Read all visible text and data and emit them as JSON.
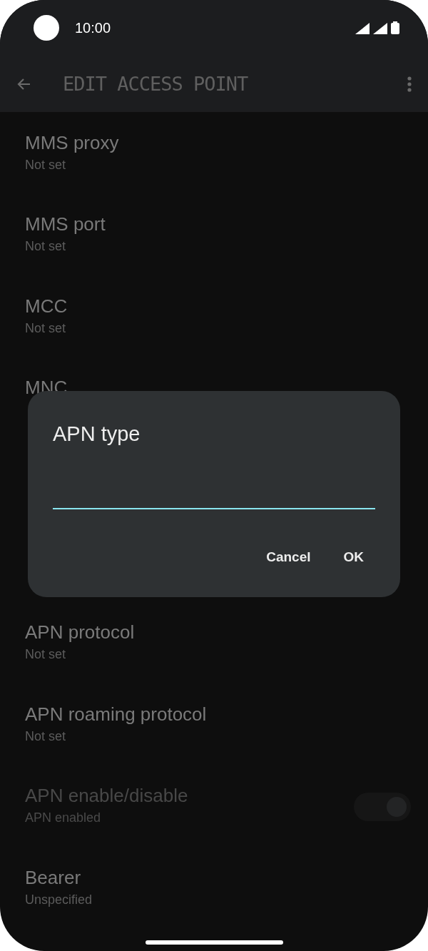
{
  "status_bar": {
    "time": "10:00"
  },
  "toolbar": {
    "title": "EDIT ACCESS POINT"
  },
  "items": [
    {
      "kind": "text",
      "title": "MMS proxy",
      "subtitle": "Not set"
    },
    {
      "kind": "text",
      "title": "MMS port",
      "subtitle": "Not set"
    },
    {
      "kind": "text",
      "title": "MCC",
      "subtitle": "Not set"
    },
    {
      "kind": "text",
      "title": "MNC"
    },
    {
      "kind": "covered"
    },
    {
      "kind": "covered"
    },
    {
      "kind": "text",
      "title": "APN protocol",
      "subtitle": "Not set"
    },
    {
      "kind": "text",
      "title": "APN roaming protocol",
      "subtitle": "Not set"
    },
    {
      "kind": "switch",
      "title": "APN enable/disable",
      "subtitle": "APN enabled",
      "disabled": true,
      "on": true
    },
    {
      "kind": "text",
      "title": "Bearer",
      "subtitle": "Unspecified"
    }
  ],
  "dialog": {
    "title": "APN type",
    "buttons": [
      "Cancel",
      "OK"
    ]
  }
}
